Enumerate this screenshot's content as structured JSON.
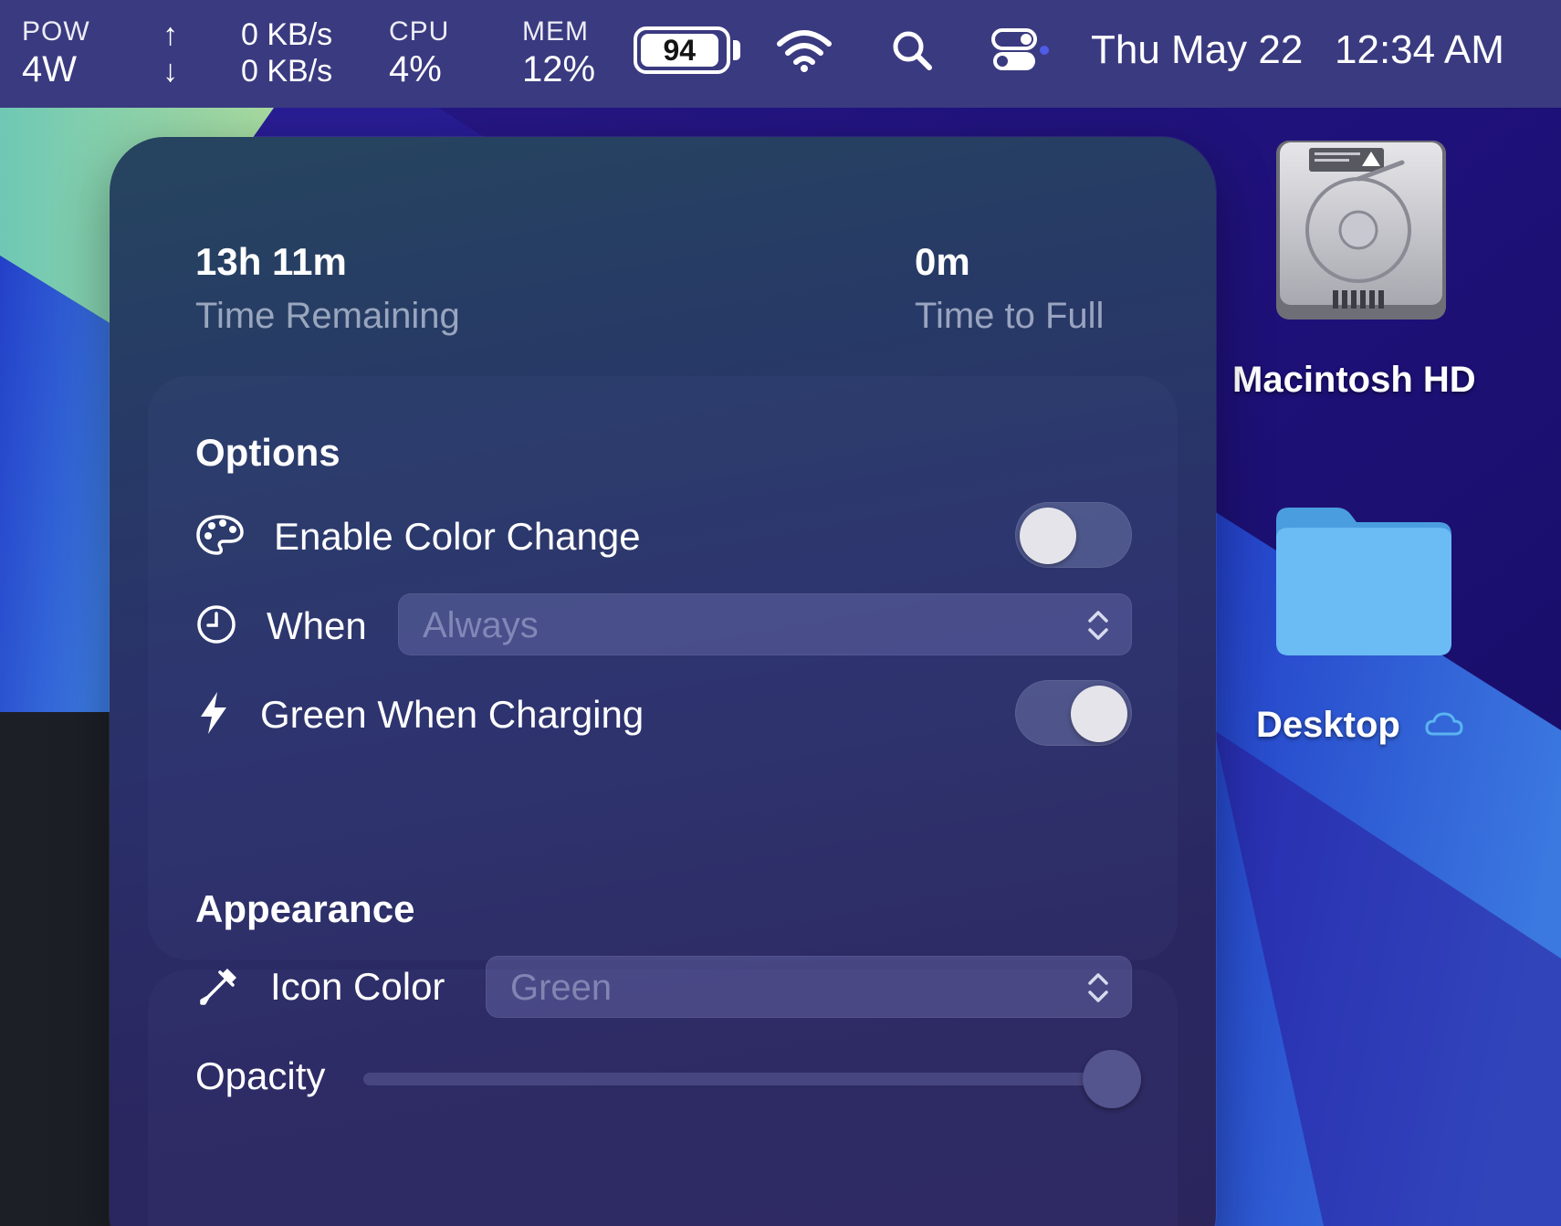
{
  "menubar": {
    "power": {
      "label": "POW",
      "value": "4W"
    },
    "network": {
      "up_arrow": "↑",
      "down_arrow": "↓",
      "upload": "0 KB/s",
      "download": "0 KB/s"
    },
    "cpu": {
      "label": "CPU",
      "value": "4%"
    },
    "memory": {
      "label": "MEM",
      "value": "12%"
    },
    "battery": {
      "level": "94",
      "level_fraction": 0.94
    },
    "icons": [
      "wifi-icon",
      "search-icon",
      "control-center-icon"
    ],
    "date": "Thu May 22",
    "time": "12:34 AM"
  },
  "battery_panel": {
    "time_remaining": {
      "value": "13h 11m",
      "label": "Time Remaining"
    },
    "time_to_full": {
      "value": "0m",
      "label": "Time to Full"
    },
    "options": {
      "title": "Options",
      "enable_color_change": {
        "label": "Enable Color Change",
        "on": false,
        "icon": "palette-icon"
      },
      "when": {
        "label": "When",
        "value": "Always",
        "icon": "clock-icon"
      },
      "green_when_charging": {
        "label": "Green When Charging",
        "on": true,
        "icon": "bolt-icon"
      }
    },
    "appearance": {
      "title": "Appearance",
      "icon_color": {
        "label": "Icon Color",
        "value": "Green",
        "icon": "eyedropper-icon"
      },
      "opacity": {
        "label": "Opacity",
        "value": 1.0
      }
    }
  },
  "desktop": {
    "items": [
      {
        "label": "Macintosh HD",
        "icon": "hard-drive-icon"
      },
      {
        "label": "Desktop",
        "icon": "folder-icon",
        "badge_icon": "icloud-icon"
      }
    ]
  },
  "colors": {
    "menubar": "#3a3a80",
    "panel": "#2a2f6a",
    "folder": "#5fb0f0",
    "toggle_knob": "#e4e4ea"
  }
}
